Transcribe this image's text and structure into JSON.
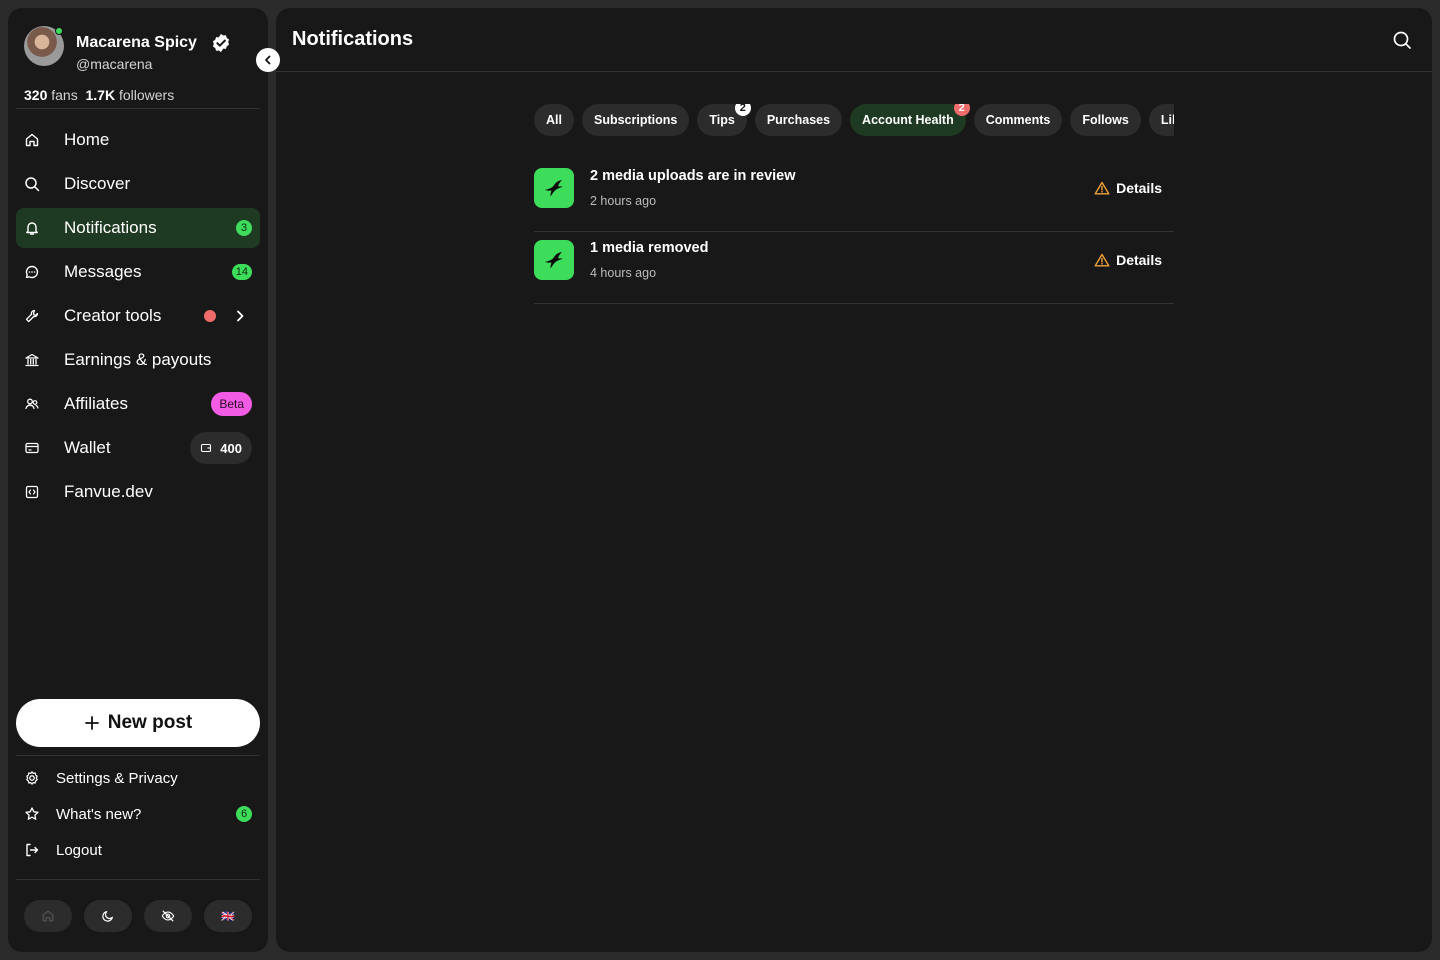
{
  "profile": {
    "name": "Macarena Spicy",
    "handle": "@macarena",
    "fans_count": "320",
    "fans_label": "fans",
    "followers_count": "1.7K",
    "followers_label": "followers"
  },
  "nav": {
    "home": "Home",
    "discover": "Discover",
    "notifications": "Notifications",
    "notifications_badge": "3",
    "messages": "Messages",
    "messages_badge": "14",
    "creator_tools": "Creator tools",
    "earnings": "Earnings & payouts",
    "affiliates": "Affiliates",
    "affiliates_badge": "Beta",
    "wallet": "Wallet",
    "wallet_balance": "400",
    "fanvue_dev": "Fanvue.dev"
  },
  "new_post_label": "New post",
  "bottom_nav": {
    "settings": "Settings & Privacy",
    "whats_new": "What's new?",
    "whats_new_badge": "6",
    "logout": "Logout"
  },
  "toolbar": {
    "language_flag": "🇬🇧"
  },
  "page": {
    "title": "Notifications"
  },
  "filters": [
    {
      "label": "All"
    },
    {
      "label": "Subscriptions"
    },
    {
      "label": "Tips",
      "count": "2"
    },
    {
      "label": "Purchases"
    },
    {
      "label": "Account Health",
      "count": "2"
    },
    {
      "label": "Comments"
    },
    {
      "label": "Follows"
    },
    {
      "label": "Likes"
    }
  ],
  "notifications": [
    {
      "title": "2 media uploads are in review",
      "time": "2 hours ago",
      "action": "Details"
    },
    {
      "title": "1 media removed",
      "time": "4 hours ago",
      "action": "Details"
    }
  ],
  "colors": {
    "accent": "#3ddc5a",
    "warning": "#f0a23a",
    "danger": "#f06b6b",
    "beta": "#f25ce5"
  }
}
